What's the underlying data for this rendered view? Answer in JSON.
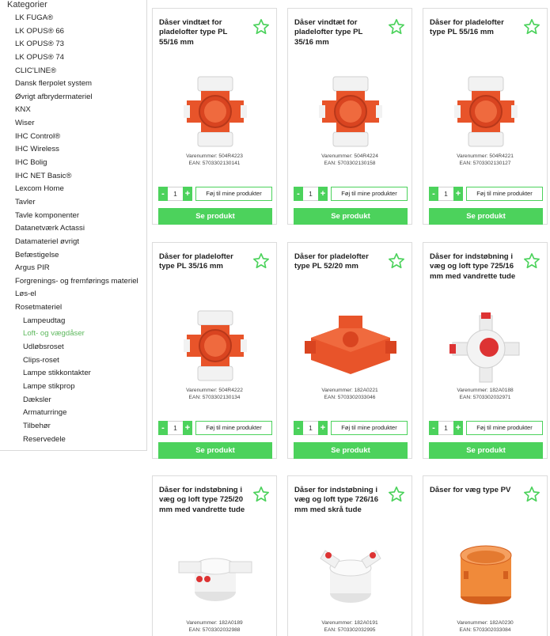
{
  "sidebar": {
    "title": "Kategorier",
    "items": [
      {
        "label": "LK FUGA®"
      },
      {
        "label": "LK OPUS® 66"
      },
      {
        "label": "LK OPUS® 73"
      },
      {
        "label": "LK OPUS® 74"
      },
      {
        "label": "CLIC'LINE®"
      },
      {
        "label": "Dansk flerpolet system"
      },
      {
        "label": "Øvrigt afbrydermateriel"
      },
      {
        "label": "KNX"
      },
      {
        "label": "Wiser"
      },
      {
        "label": "IHC Control®"
      },
      {
        "label": "IHC Wireless"
      },
      {
        "label": "IHC Bolig"
      },
      {
        "label": "IHC NET Basic®"
      },
      {
        "label": "Lexcom Home"
      },
      {
        "label": "Tavler"
      },
      {
        "label": "Tavle komponenter"
      },
      {
        "label": "Datanetværk Actassi"
      },
      {
        "label": "Datamateriel øvrigt"
      },
      {
        "label": "Befæstigelse"
      },
      {
        "label": "Argus PIR"
      },
      {
        "label": "Forgrenings- og fremførings materiel"
      },
      {
        "label": "Løs-el"
      },
      {
        "label": "Rosetmateriel"
      }
    ],
    "subitems": [
      {
        "label": "Lampeudtag"
      },
      {
        "label": "Loft- og vægdåser",
        "active": true
      },
      {
        "label": "Udløbsroset"
      },
      {
        "label": "Clips-roset"
      },
      {
        "label": "Lampe stikkontakter"
      },
      {
        "label": "Lampe stikprop"
      },
      {
        "label": "Dæksler"
      },
      {
        "label": "Armaturringe"
      },
      {
        "label": "Tilbehør"
      },
      {
        "label": "Reservedele"
      }
    ]
  },
  "products": [
    {
      "name": "Dåser vindtæt for pladelofter type PL 55/16 mm",
      "varenummer": "Varenummer: 504R4223",
      "ean": "EAN: 5703302130141",
      "qty": "1",
      "add_label": "Føj til mine produkter",
      "view_label": "Se produkt",
      "image": "orange-cross-box"
    },
    {
      "name": "Dåser vindtæt for pladelofter type PL 35/16 mm",
      "varenummer": "Varenummer: 504R4224",
      "ean": "EAN: 5703302130158",
      "qty": "1",
      "add_label": "Føj til mine produkter",
      "view_label": "Se produkt",
      "image": "orange-cross-box"
    },
    {
      "name": "Dåser for pladelofter type PL 55/16 mm",
      "varenummer": "Varenummer: 504R4221",
      "ean": "EAN: 5703302130127",
      "qty": "1",
      "add_label": "Føj til mine produkter",
      "view_label": "Se produkt",
      "image": "orange-cross-box"
    },
    {
      "name": "Dåser for pladelofter type PL 35/16 mm",
      "varenummer": "Varenummer: 504R4222",
      "ean": "EAN: 5703302130134",
      "qty": "1",
      "add_label": "Føj til mine produkter",
      "view_label": "Se produkt",
      "image": "orange-cross-box"
    },
    {
      "name": "Dåser for pladelofter type PL 52/20 mm",
      "varenummer": "Varenummer: 182A0221",
      "ean": "EAN: 5703302033046",
      "qty": "1",
      "add_label": "Føj til mine produkter",
      "view_label": "Se produkt",
      "image": "orange-flat-box"
    },
    {
      "name": "Dåser for indstøbning i væg og loft type 725/16 mm med vandrette tude",
      "varenummer": "Varenummer: 182A0188",
      "ean": "EAN: 5703302032971",
      "qty": "1",
      "add_label": "Føj til mine produkter",
      "view_label": "Se produkt",
      "image": "white-round-box"
    },
    {
      "name": "Dåser for indstøbning i væg og loft type 725/20 mm med vandrette tude",
      "varenummer": "Varenummer: 182A0189",
      "ean": "EAN: 5703302032988",
      "image": "white-tube-box"
    },
    {
      "name": "Dåser for indstøbning i væg og loft type 726/16 mm med skrå tude",
      "varenummer": "Varenummer: 182A0191",
      "ean": "EAN: 5703302032995",
      "image": "white-angled-box"
    },
    {
      "name": "Dåser for væg type PV",
      "varenummer": "Varenummer: 182A0230",
      "ean": "EAN: 5703302033084",
      "image": "orange-cup-box"
    }
  ],
  "colors": {
    "accent": "#4cd25c",
    "active_link": "#5cb85c",
    "product_orange": "#e8542a"
  }
}
